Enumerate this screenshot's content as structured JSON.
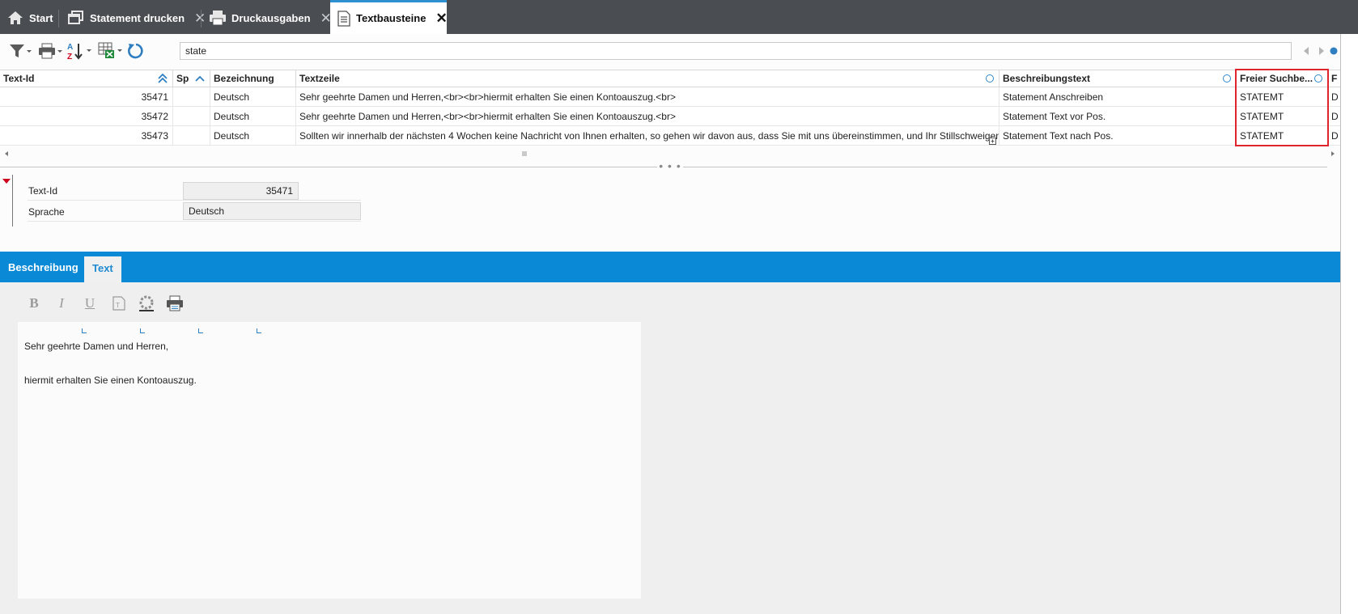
{
  "tabs": [
    {
      "label": "Start",
      "icon": "home-icon",
      "closable": false
    },
    {
      "label": "Statement drucken",
      "icon": "windows-icon",
      "closable": true
    },
    {
      "label": "Druckausgaben",
      "icon": "printer-icon",
      "closable": true
    },
    {
      "label": "Textbausteine",
      "icon": "document-icon",
      "closable": true,
      "active": true
    }
  ],
  "toolbar": {
    "icons": [
      "filter-icon",
      "print-menu-icon",
      "sort-az-icon",
      "export-excel-icon",
      "refresh-icon"
    ],
    "search_value": "state"
  },
  "grid": {
    "columns": [
      "Text-Id",
      "Sp",
      "Bezeichnung",
      "Textzeile",
      "Beschreibungstext",
      "Freier Suchbe...",
      "F"
    ],
    "rows": [
      {
        "id": "35471",
        "sp": "",
        "bez": "Deutsch",
        "textzeile": "Sehr geehrte Damen und Herren,<br><br>hiermit erhalten Sie einen Kontoauszug.<br>",
        "beschreibung": "Statement Anschreiben",
        "suchbegriff": "STATEMT",
        "f": "D"
      },
      {
        "id": "35472",
        "sp": "",
        "bez": "Deutsch",
        "textzeile": "Sehr geehrte Damen und Herren,<br><br>hiermit erhalten Sie einen Kontoauszug.<br>",
        "beschreibung": "Statement Text vor Pos.",
        "suchbegriff": "STATEMT",
        "f": "D"
      },
      {
        "id": "35473",
        "sp": "",
        "bez": "Deutsch",
        "textzeile": "Sollten wir innerhalb der nächsten 4 Wochen keine Nachricht von Ihnen erhalten, so gehen wir davon aus, dass Sie mit uns übereinstimmen, und Ihr Stillschweigen",
        "beschreibung": "Statement Text nach Pos.",
        "suchbegriff": "STATEMT",
        "f": "D"
      }
    ]
  },
  "detail": {
    "text_id_label": "Text-Id",
    "text_id_value": "35471",
    "sprache_label": "Sprache",
    "sprache_value": "Deutsch"
  },
  "subtabs": [
    "Beschreibung",
    "Text"
  ],
  "editor": {
    "format_icons": [
      "bold-icon",
      "italic-icon",
      "underline-icon",
      "clear-format-icon",
      "color-picker-icon",
      "print-icon"
    ],
    "lines": [
      "Sehr geehrte Damen und Herren,",
      "hiermit erhalten Sie einen Kontoauszug."
    ]
  },
  "colors": {
    "tabbar": "#4a4d51",
    "accent_blue": "#0a8ad6",
    "highlight_red": "#e0242b"
  }
}
